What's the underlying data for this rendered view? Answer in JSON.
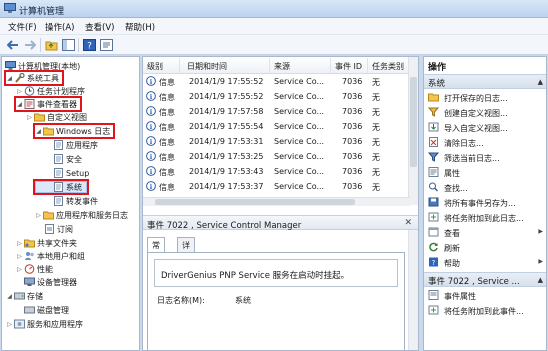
{
  "window": {
    "title": "计算机管理"
  },
  "menu": [
    "文件(F)",
    "操作(A)",
    "查看(V)",
    "帮助(H)"
  ],
  "tree": {
    "root": "计算机管理(本地)",
    "system_tools": "系统工具",
    "task_scheduler": "任务计划程序",
    "event_viewer": "事件查看器",
    "custom_views": "自定义视图",
    "windows_logs": "Windows 日志",
    "application": "应用程序",
    "security": "安全",
    "setup": "Setup",
    "system": "系统",
    "forwarded": "转发事件",
    "app_service_logs": "应用程序和服务日志",
    "subscriptions": "订阅",
    "shared_folders": "共享文件夹",
    "local_users": "本地用户和组",
    "performance": "性能",
    "device_manager": "设备管理器",
    "storage": "存储",
    "disk_mgmt": "磁盘管理",
    "services_apps": "服务和应用程序"
  },
  "grid": {
    "columns": [
      "级别",
      "日期和时间",
      "来源",
      "事件 ID",
      "任务类别"
    ],
    "rows": [
      {
        "level": "信息",
        "datetime": "2014/1/9 17:55:52",
        "source": "Service Co...",
        "id": "7036",
        "task": "无"
      },
      {
        "level": "信息",
        "datetime": "2014/1/9 17:55:52",
        "source": "Service Co...",
        "id": "7036",
        "task": "无"
      },
      {
        "level": "信息",
        "datetime": "2014/1/9 17:57:58",
        "source": "Service Co...",
        "id": "7036",
        "task": "无"
      },
      {
        "level": "信息",
        "datetime": "2014/1/9 17:55:54",
        "source": "Service Co...",
        "id": "7036",
        "task": "无"
      },
      {
        "level": "信息",
        "datetime": "2014/1/9 17:53:31",
        "source": "Service Co...",
        "id": "7036",
        "task": "无"
      },
      {
        "level": "信息",
        "datetime": "2014/1/9 17:53:25",
        "source": "Service Co...",
        "id": "7036",
        "task": "无"
      },
      {
        "level": "信息",
        "datetime": "2014/1/9 17:53:43",
        "source": "Service Co...",
        "id": "7036",
        "task": "无"
      },
      {
        "level": "信息",
        "datetime": "2014/1/9 17:53:37",
        "source": "Service Co...",
        "id": "7036",
        "task": "无"
      }
    ]
  },
  "detail": {
    "title": "事件 7022 , Service Control Manager",
    "tabs": [
      "常规",
      "详细信息"
    ],
    "description": "DriverGenius PNP Service 服务在启动时挂起。",
    "log_name_label": "日志名称(M):",
    "log_name_value": "系统"
  },
  "actions": {
    "header": "操作",
    "section1": "系统",
    "items1": [
      {
        "label": "打开保存的日志...",
        "icon": "folder-open-icon"
      },
      {
        "label": "创建自定义视图...",
        "icon": "filter-icon"
      },
      {
        "label": "导入自定义视图...",
        "icon": "import-icon"
      },
      {
        "label": "清除日志...",
        "icon": "clear-log-icon"
      },
      {
        "label": "筛选当前日志...",
        "icon": "funnel-icon"
      },
      {
        "label": "属性",
        "icon": "properties-icon"
      },
      {
        "label": "查找...",
        "icon": "find-icon"
      },
      {
        "label": "将所有事件另存为...",
        "icon": "save-icon"
      },
      {
        "label": "将任务附加到此日志...",
        "icon": "attach-task-icon"
      },
      {
        "label": "查看",
        "icon": "view-icon",
        "submenu": true
      },
      {
        "label": "刷新",
        "icon": "refresh-icon"
      },
      {
        "label": "帮助",
        "icon": "help-icon",
        "submenu": true
      }
    ],
    "section2": "事件 7022 , Service ...",
    "items2": [
      {
        "label": "事件属性",
        "icon": "event-properties-icon"
      },
      {
        "label": "将任务附加到此事件...",
        "icon": "attach-task-icon"
      }
    ]
  }
}
